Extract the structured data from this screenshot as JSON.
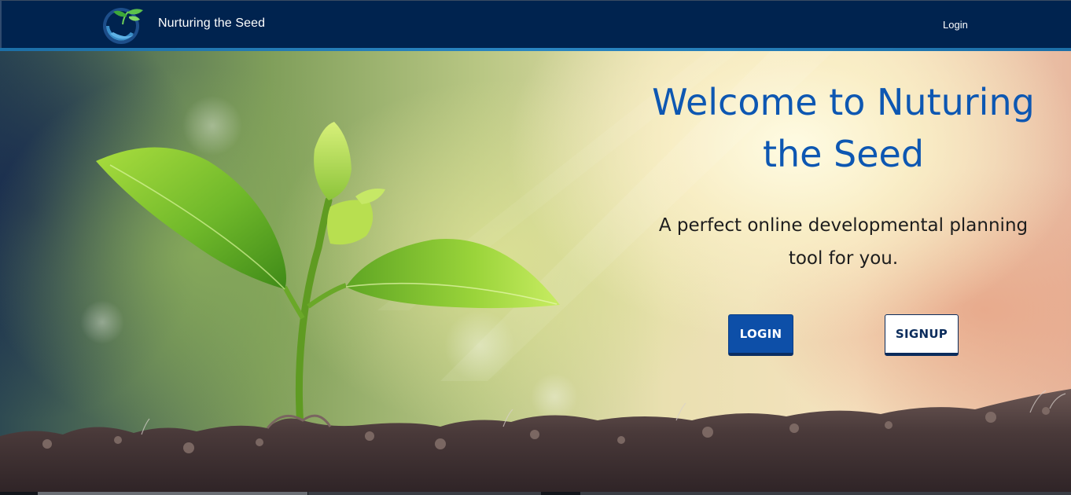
{
  "navbar": {
    "logo_icon": "seedling-hands-logo-icon",
    "brand": "Nurturing the Seed",
    "login_link": "Login",
    "background_color": "#00234f",
    "underline_color": "#2a86c2"
  },
  "hero": {
    "title": "Welcome to Nuturing the Seed",
    "subtitle": "A perfect online developmental planning tool for you.",
    "title_color": "#0d57b2",
    "buttons": {
      "login": "LOGIN",
      "signup": "SIGNUP"
    },
    "login_button_color": "#0d4fa8",
    "signup_button_color": "#ffffff"
  }
}
